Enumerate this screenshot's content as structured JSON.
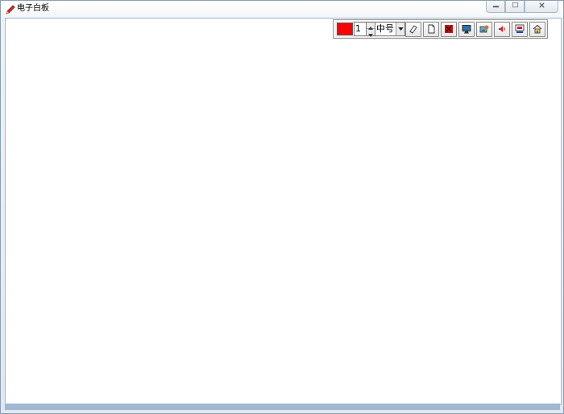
{
  "window": {
    "title": "电子白板"
  },
  "toolbar": {
    "pen_color": "#ff0000",
    "line_width": "1",
    "text_size": "中号",
    "buttons": [
      {
        "name": "eraser-button",
        "icon": "eraser-icon"
      },
      {
        "name": "new-page-button",
        "icon": "blank-page-icon"
      },
      {
        "name": "clear-button",
        "icon": "clear-icon"
      },
      {
        "name": "screen-button",
        "icon": "monitor-icon"
      },
      {
        "name": "image-button",
        "icon": "picture-icon"
      },
      {
        "name": "sound-button",
        "icon": "speaker-icon"
      },
      {
        "name": "capture-button",
        "icon": "screen-capture-icon"
      },
      {
        "name": "home-button",
        "icon": "home-icon"
      }
    ]
  }
}
